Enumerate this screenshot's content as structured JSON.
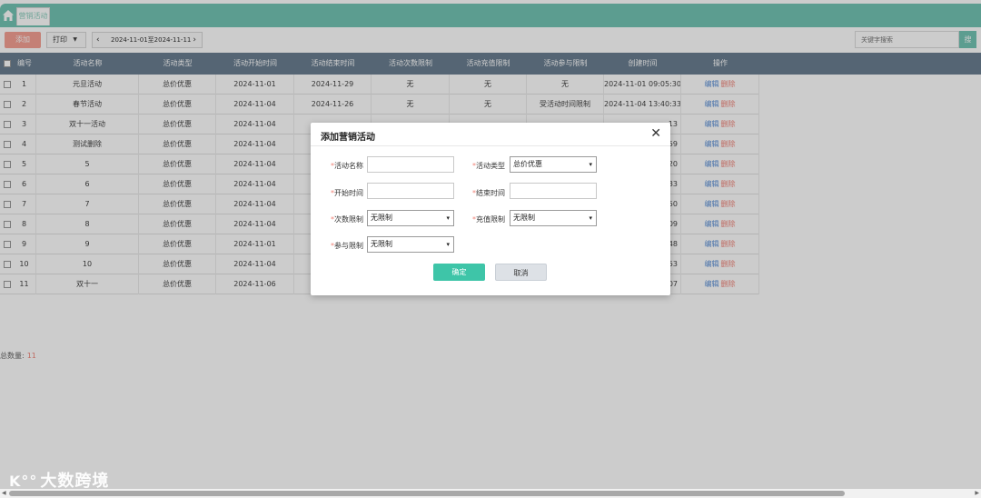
{
  "tabs": [
    {
      "label": "营销活动"
    }
  ],
  "toolbar": {
    "add_label": "添加",
    "print_label": "打印",
    "date_range": "2024-11-01至2024-11-11",
    "search_placeholder": "关键字搜索",
    "search_btn": "搜"
  },
  "table": {
    "headers": [
      "编号",
      "活动名称",
      "活动类型",
      "活动开始时间",
      "活动结束时间",
      "活动次数限制",
      "活动充值限制",
      "活动参与限制",
      "创建时间",
      "操作"
    ],
    "rows": [
      [
        "1",
        "元旦活动",
        "总价优惠",
        "2024-11-01",
        "2024-11-29",
        "无",
        "无",
        "无",
        "2024-11-01 09:05:30"
      ],
      [
        "2",
        "春节活动",
        "总价优惠",
        "2024-11-04",
        "2024-11-26",
        "无",
        "无",
        "受活动时间限制",
        "2024-11-04 13:40:33"
      ],
      [
        "3",
        "双十一活动",
        "总价优惠",
        "2024-11-04",
        "",
        "",
        "",
        "",
        "13"
      ],
      [
        "4",
        "测试删除",
        "总价优惠",
        "2024-11-04",
        "",
        "",
        "",
        "",
        "59"
      ],
      [
        "5",
        "5",
        "总价优惠",
        "2024-11-04",
        "",
        "",
        "",
        "",
        "20"
      ],
      [
        "6",
        "6",
        "总价优惠",
        "2024-11-04",
        "",
        "",
        "",
        "",
        "33"
      ],
      [
        "7",
        "7",
        "总价优惠",
        "2024-11-04",
        "",
        "",
        "",
        "",
        "50"
      ],
      [
        "8",
        "8",
        "总价优惠",
        "2024-11-04",
        "",
        "",
        "",
        "",
        "09"
      ],
      [
        "9",
        "9",
        "总价优惠",
        "2024-11-01",
        "",
        "",
        "",
        "",
        "48"
      ],
      [
        "10",
        "10",
        "总价优惠",
        "2024-11-04",
        "",
        "",
        "",
        "",
        "53"
      ],
      [
        "11",
        "双十一",
        "总价优惠",
        "2024-11-06",
        "",
        "",
        "",
        "",
        "07"
      ]
    ],
    "op_edit": "编辑",
    "op_delete": "删除",
    "total_label": "总数量:",
    "total_value": "11"
  },
  "modal": {
    "title": "添加营销活动",
    "fields": {
      "name_label": "活动名称",
      "type_label": "活动类型",
      "type_value": "总价优惠",
      "start_label": "开始时间",
      "end_label": "结束时间",
      "count_label": "次数限制",
      "count_value": "无限制",
      "recharge_label": "充值限制",
      "recharge_value": "无限制",
      "join_label": "参与限制",
      "join_value": "无限制"
    },
    "ok_label": "确定",
    "cancel_label": "取消"
  },
  "watermark": {
    "text": "大数跨境",
    "logo": "K°°"
  },
  "colors": {
    "accent": "#73c5b4",
    "header": "#6b7f91",
    "add": "#f5a094",
    "ok": "#3ec5a8"
  }
}
